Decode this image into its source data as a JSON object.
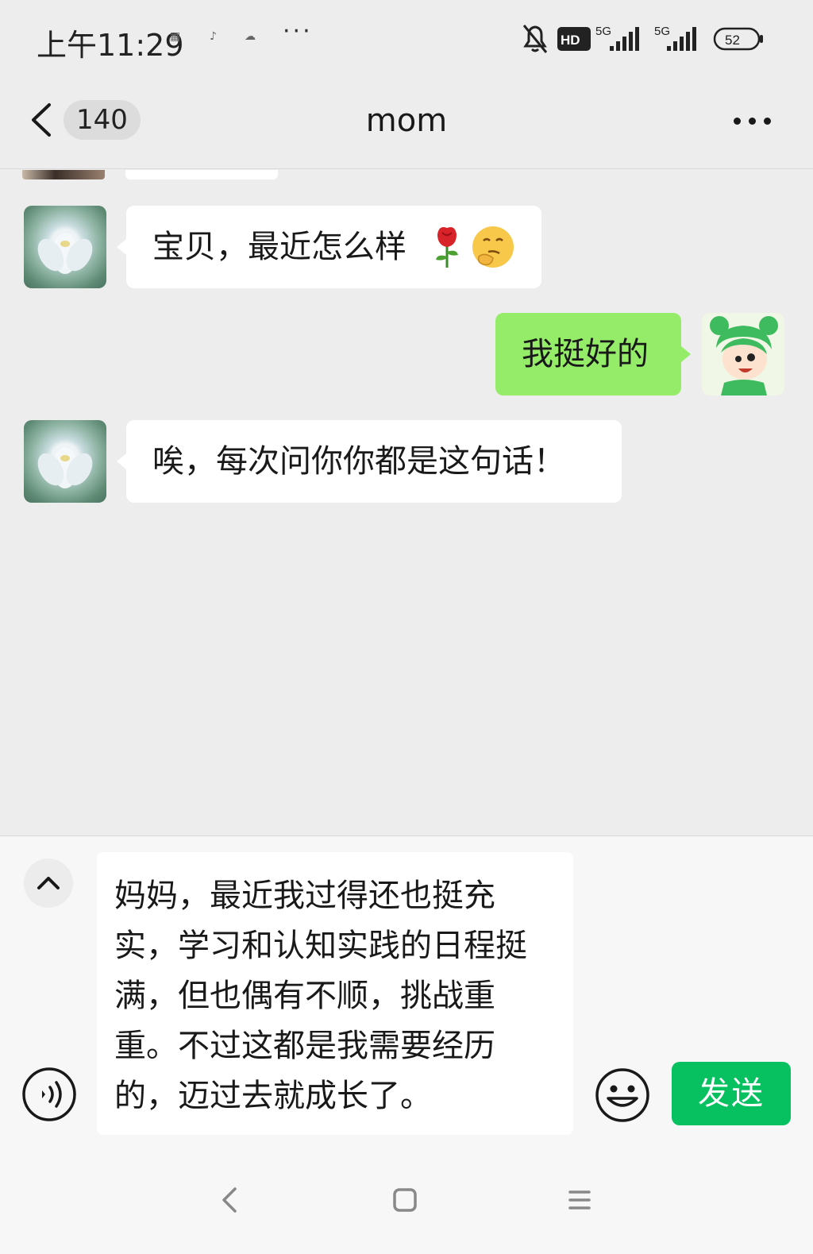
{
  "status_bar": {
    "time": "上午11:29",
    "more": "···",
    "network_labels": [
      "HD",
      "5G",
      "5G"
    ],
    "battery": "52"
  },
  "header": {
    "back_icon": "chevron-left-icon",
    "unread_count": "140",
    "title": "mom",
    "more_icon": "more-dots-icon"
  },
  "messages": [
    {
      "from": "mom",
      "text": "宝贝，最近怎么样",
      "emojis": [
        "rose-icon",
        "thinking-face-icon"
      ]
    },
    {
      "from": "me",
      "text": "我挺好的"
    },
    {
      "from": "mom",
      "text": "唉，每次问你你都是这句话！"
    }
  ],
  "input": {
    "text": "妈妈，最近我过得还也挺充实，学习和认知实践的日程挺满，但也偶有不顺，挑战重重。不过这都是我需要经历的，迈过去就成长了。",
    "send_label": "发送"
  },
  "colors": {
    "background": "#ededed",
    "my_bubble": "#95ec69",
    "send_button": "#07c160"
  }
}
